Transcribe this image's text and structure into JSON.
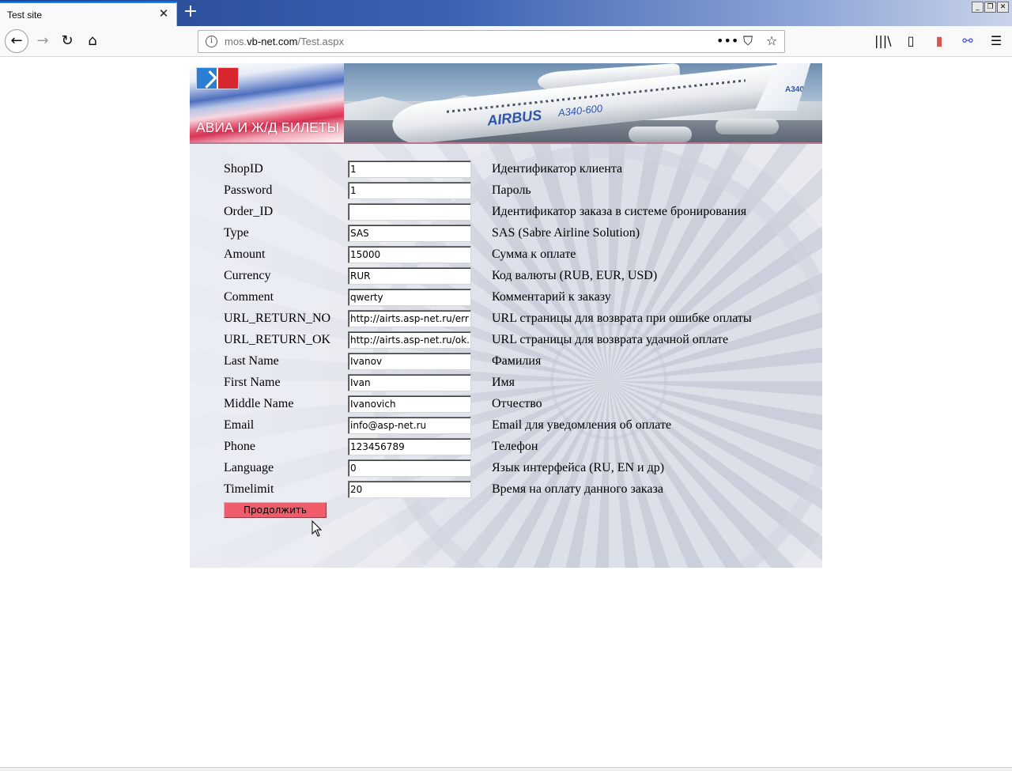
{
  "browser": {
    "tab_title": "Test site",
    "tab_close": "✕",
    "new_tab": "+",
    "window_buttons": [
      "_",
      "❐",
      "✕"
    ],
    "url_prefix": "mos.",
    "url_host": "vb-net.com",
    "url_path": "/Test.aspx",
    "url_info_icon": "i",
    "nav": {
      "back": "←",
      "forward": "→",
      "reload": "↻",
      "home": "⌂"
    },
    "url_actions": {
      "more": "•••",
      "pocket": "⛉",
      "bookmark": "☆"
    },
    "toolbar": {
      "library": "|||\\",
      "sidebar": "▯",
      "ext1": "▮",
      "ext2": "⚯",
      "menu": "☰"
    }
  },
  "banner": {
    "title": "АВИА И Ж/Д БИЛЕТЫ",
    "plane_brand": "AIRBUS",
    "plane_model": "A340-600",
    "tail_text": "A340"
  },
  "form": {
    "rows": [
      {
        "label": "ShopID",
        "value": "1",
        "description": "Идентификатор клиента"
      },
      {
        "label": "Password",
        "value": "1",
        "description": "Пароль"
      },
      {
        "label": "Order_ID",
        "value": "",
        "description": "Идентификатор заказа в системе бронирования"
      },
      {
        "label": "Type",
        "value": "SAS",
        "description": "SAS (Sabre Airline Solution)"
      },
      {
        "label": "Amount",
        "value": "15000",
        "description": "Сумма к оплате"
      },
      {
        "label": "Currency",
        "value": "RUR",
        "description": "Код валюты (RUB, EUR, USD)"
      },
      {
        "label": "Comment",
        "value": "qwerty",
        "description": "Комментарий к заказу"
      },
      {
        "label": "URL_RETURN_NO",
        "value": "http://airts.asp-net.ru/err.",
        "description": "URL страницы для возврата при ошибке оплаты"
      },
      {
        "label": "URL_RETURN_OK",
        "value": "http://airts.asp-net.ru/ok.a",
        "description": "URL страницы для возврата удачной оплате"
      },
      {
        "label": "Last Name",
        "value": "Ivanov",
        "description": "Фамилия"
      },
      {
        "label": "First Name",
        "value": "Ivan",
        "description": "Имя"
      },
      {
        "label": "Middle Name",
        "value": "Ivanovich",
        "description": "Отчество"
      },
      {
        "label": "Email",
        "value": "info@asp-net.ru",
        "description": "Email для уведомления об оплате"
      },
      {
        "label": "Phone",
        "value": "123456789",
        "description": "Телефон"
      },
      {
        "label": "Language",
        "value": "0",
        "description": "Язык интерфейса (RU, EN и др)"
      },
      {
        "label": "Timelimit",
        "value": "20",
        "description": "Время на оплату данного заказа"
      }
    ],
    "submit_label": "Продолжить"
  },
  "colors": {
    "submit_button": "#ef5d6d",
    "tab_accent": "#0a84ff",
    "tabbar_start": "#24458f"
  }
}
